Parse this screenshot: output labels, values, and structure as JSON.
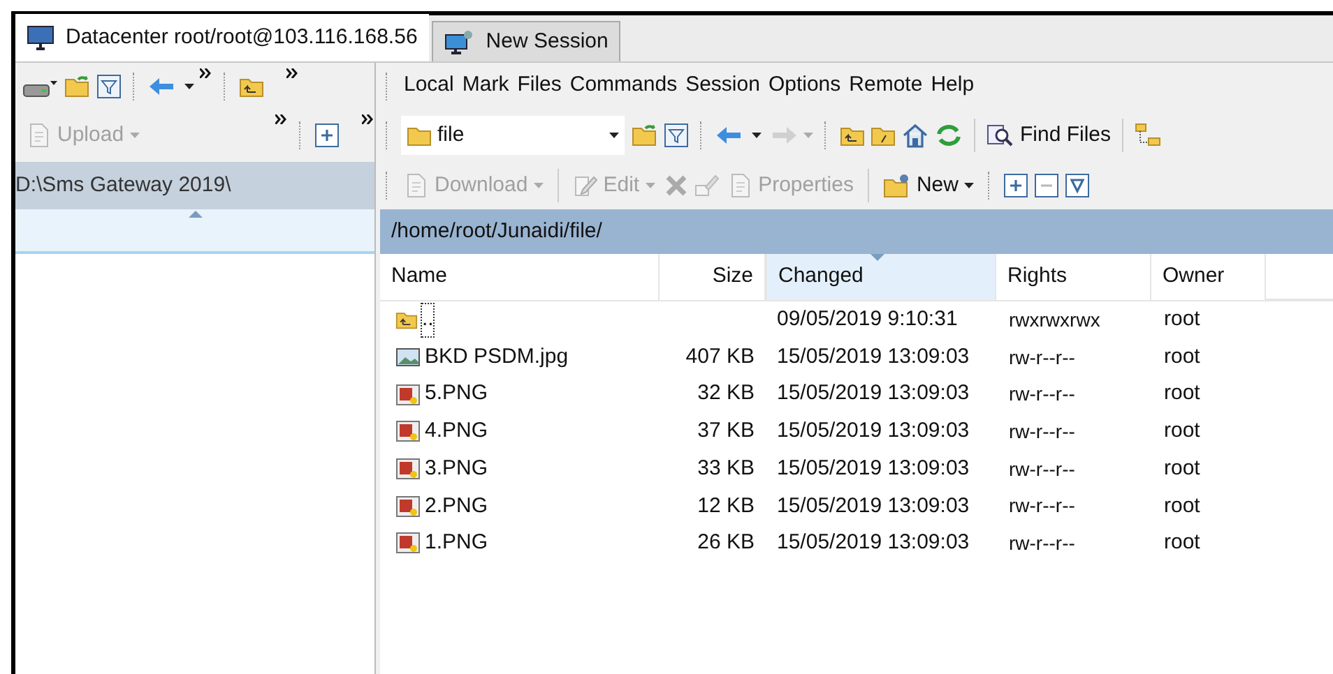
{
  "tabs": [
    {
      "label": "Datacenter root/root@103.116.168.56",
      "selected": true,
      "kind": "session"
    },
    {
      "label": "New Session",
      "selected": false,
      "kind": "new"
    }
  ],
  "menu": [
    "Local",
    "Mark",
    "Files",
    "Commands",
    "Session",
    "Options",
    "Remote",
    "Help"
  ],
  "left_toolbar": {
    "upload": {
      "label": "Upload",
      "disabled": true
    }
  },
  "left_path": "D:\\Sms Gateway 2019\\",
  "remote_toolbar": {
    "folder": "file",
    "find": {
      "label": "Find Files",
      "disabled": false
    }
  },
  "remote_actions": [
    {
      "label": "Download",
      "kind": "download",
      "disabled": true
    },
    {
      "label": "Edit",
      "kind": "edit",
      "disabled": true
    },
    {
      "label": "Properties",
      "kind": "properties",
      "disabled": true
    },
    {
      "label": "New",
      "kind": "new",
      "disabled": false
    }
  ],
  "remote_path": "/home/root/Junaidi/file/",
  "columns": [
    {
      "label": "Name",
      "sorted": false
    },
    {
      "label": "Size",
      "sorted": false
    },
    {
      "label": "Changed",
      "sorted": true
    },
    {
      "label": "Rights",
      "sorted": false
    },
    {
      "label": "Owner",
      "sorted": false
    }
  ],
  "rows": [
    {
      "kind": "parent",
      "name": "..",
      "size": "",
      "changed": "09/05/2019 9:10:31",
      "rights": "rwxrwxrwx",
      "owner": "root",
      "focused": true
    },
    {
      "kind": "image",
      "name": "BKD PSDM.jpg",
      "size": "407 KB",
      "changed": "15/05/2019 13:09:03",
      "rights": "rw-r--r--",
      "owner": "root",
      "focused": false
    },
    {
      "kind": "png",
      "name": "5.PNG",
      "size": "32 KB",
      "changed": "15/05/2019 13:09:03",
      "rights": "rw-r--r--",
      "owner": "root",
      "focused": false
    },
    {
      "kind": "png",
      "name": "4.PNG",
      "size": "37 KB",
      "changed": "15/05/2019 13:09:03",
      "rights": "rw-r--r--",
      "owner": "root",
      "focused": false
    },
    {
      "kind": "png",
      "name": "3.PNG",
      "size": "33 KB",
      "changed": "15/05/2019 13:09:03",
      "rights": "rw-r--r--",
      "owner": "root",
      "focused": false
    },
    {
      "kind": "png",
      "name": "2.PNG",
      "size": "12 KB",
      "changed": "15/05/2019 13:09:03",
      "rights": "rw-r--r--",
      "owner": "root",
      "focused": false
    },
    {
      "kind": "png",
      "name": "1.PNG",
      "size": "26 KB",
      "changed": "15/05/2019 13:09:03",
      "rights": "rw-r--r--",
      "owner": "root",
      "focused": false
    }
  ]
}
